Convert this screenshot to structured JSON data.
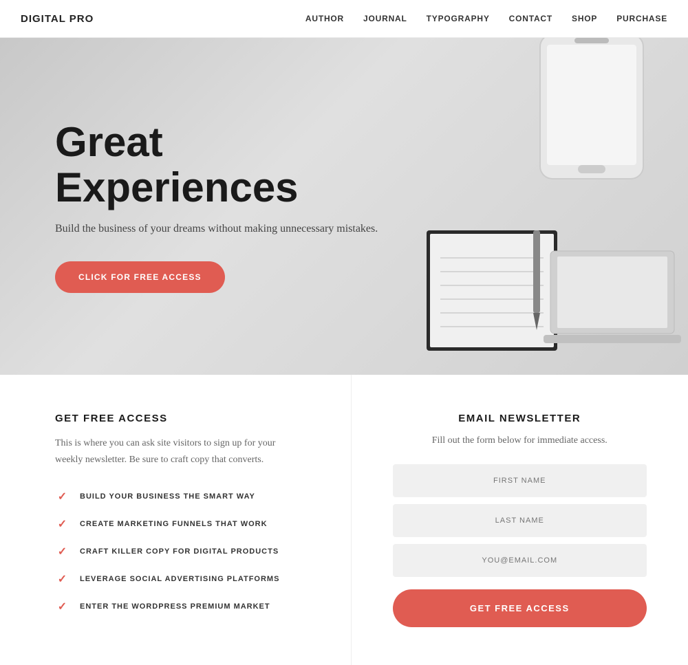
{
  "nav": {
    "logo": "DIGITAL PRO",
    "links": [
      {
        "label": "AUTHOR",
        "href": "#"
      },
      {
        "label": "JOURNAL",
        "href": "#"
      },
      {
        "label": "TYPOGRAPHY",
        "href": "#"
      },
      {
        "label": "CONTACT",
        "href": "#"
      },
      {
        "label": "SHOP",
        "href": "#"
      },
      {
        "label": "PURCHASE",
        "href": "#"
      }
    ]
  },
  "hero": {
    "title": "Great Experiences",
    "subtitle": "Build the business of your dreams without making unnecessary mistakes.",
    "cta_button": "CLICK FOR FREE ACCESS"
  },
  "left_section": {
    "title": "GET FREE ACCESS",
    "description": "This is where you can ask site visitors to sign up for your weekly newsletter. Be sure to craft copy that converts.",
    "checklist": [
      "BUILD YOUR BUSINESS THE SMART WAY",
      "CREATE MARKETING FUNNELS THAT WORK",
      "CRAFT KILLER COPY FOR DIGITAL PRODUCTS",
      "LEVERAGE SOCIAL ADVERTISING PLATFORMS",
      "ENTER THE WORDPRESS PREMIUM MARKET"
    ]
  },
  "right_section": {
    "title": "EMAIL NEWSLETTER",
    "description": "Fill out the form below for immediate access.",
    "fields": [
      {
        "placeholder": "FIRST NAME",
        "type": "text",
        "name": "first-name"
      },
      {
        "placeholder": "LAST NAME",
        "type": "text",
        "name": "last-name"
      },
      {
        "placeholder": "YOU@EMAIL.COM",
        "type": "email",
        "name": "email"
      }
    ],
    "submit_button": "GET FREE ACCESS"
  },
  "colors": {
    "accent": "#e05c52",
    "dark": "#1a1a1a",
    "mid": "#666",
    "light": "#f0f0f0"
  }
}
